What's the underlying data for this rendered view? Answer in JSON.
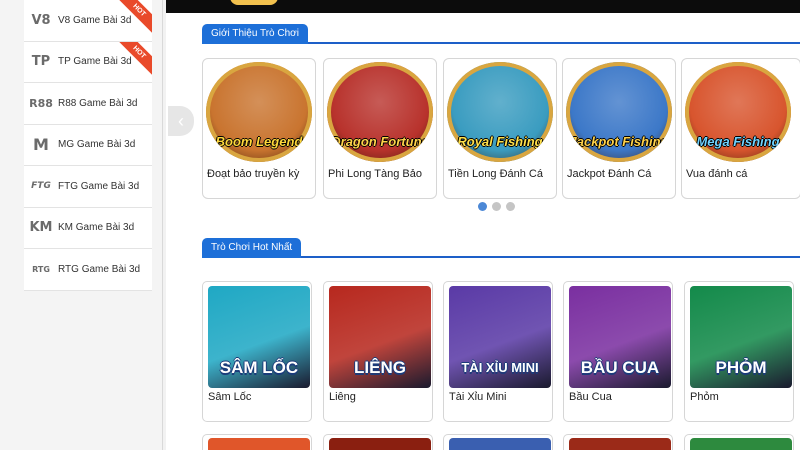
{
  "sidebar": {
    "items": [
      {
        "logo": "V8",
        "label": "V8 Game Bài 3d",
        "hot": true
      },
      {
        "logo": "TP",
        "label": "TP Game Bài 3d",
        "hot": true
      },
      {
        "logo": "R88",
        "label": "R88 Game Bài 3d",
        "hot": false
      },
      {
        "logo": "M",
        "label": "MG Game Bài 3d",
        "hot": false
      },
      {
        "logo": "FTG",
        "label": "FTG Game Bài 3d",
        "hot": false
      },
      {
        "logo": "KM",
        "label": "KM Game Bài 3d",
        "hot": false
      },
      {
        "logo": "RTG",
        "label": "RTG Game Bài 3d",
        "hot": false
      }
    ],
    "hot_label": "HOT"
  },
  "intro": {
    "tab_label": "Giới Thiệu Trò Chơi",
    "games": [
      {
        "art_title": "Boom Legend",
        "name": "Đoạt bảo truyền kỳ",
        "bg": "#c9742f",
        "title_color": "#ffd83a"
      },
      {
        "art_title": "Dragon Fortune",
        "name": "Phi Long Tàng Bảo",
        "bg": "#b8322c",
        "title_color": "#ffd34a"
      },
      {
        "art_title": "Royal Fishing",
        "name": "Tiền Long Đánh Cá",
        "bg": "#3a9cc0",
        "title_color": "#ffe04a"
      },
      {
        "art_title": "Jackpot Fishing",
        "name": "Jackpot Đánh Cá",
        "bg": "#3c78c8",
        "title_color": "#ffd24a"
      },
      {
        "art_title": "Mega Fishing",
        "name": "Vua đánh cá",
        "bg": "#d8552e",
        "title_color": "#6fd3ff"
      }
    ],
    "pager": {
      "count": 3,
      "active": 1
    }
  },
  "hot": {
    "tab_label": "Trò Chơi Hot Nhất",
    "games": [
      {
        "art_title": "SÂM LỐC",
        "name": "Sâm Lốc",
        "bg": "#1fa8c4"
      },
      {
        "art_title": "LIÊNG",
        "name": "Liêng",
        "bg": "#b7281e"
      },
      {
        "art_title": "TÀI XỈU MINI",
        "name": "Tài Xỉu Mini",
        "bg": "#5a3aa6"
      },
      {
        "art_title": "BẦU CUA",
        "name": "Bầu Cua",
        "bg": "#7a2fa0"
      },
      {
        "art_title": "PHỎM",
        "name": "Phỏm",
        "bg": "#138a4a"
      }
    ],
    "next_row_colors": [
      "#e0562a",
      "#8a1f10",
      "#3a5fb0",
      "#9b2a18",
      "#2d8a3e"
    ]
  },
  "colors": {
    "accent": "#1d6fd8",
    "hot_badge": "#e94a2a"
  }
}
